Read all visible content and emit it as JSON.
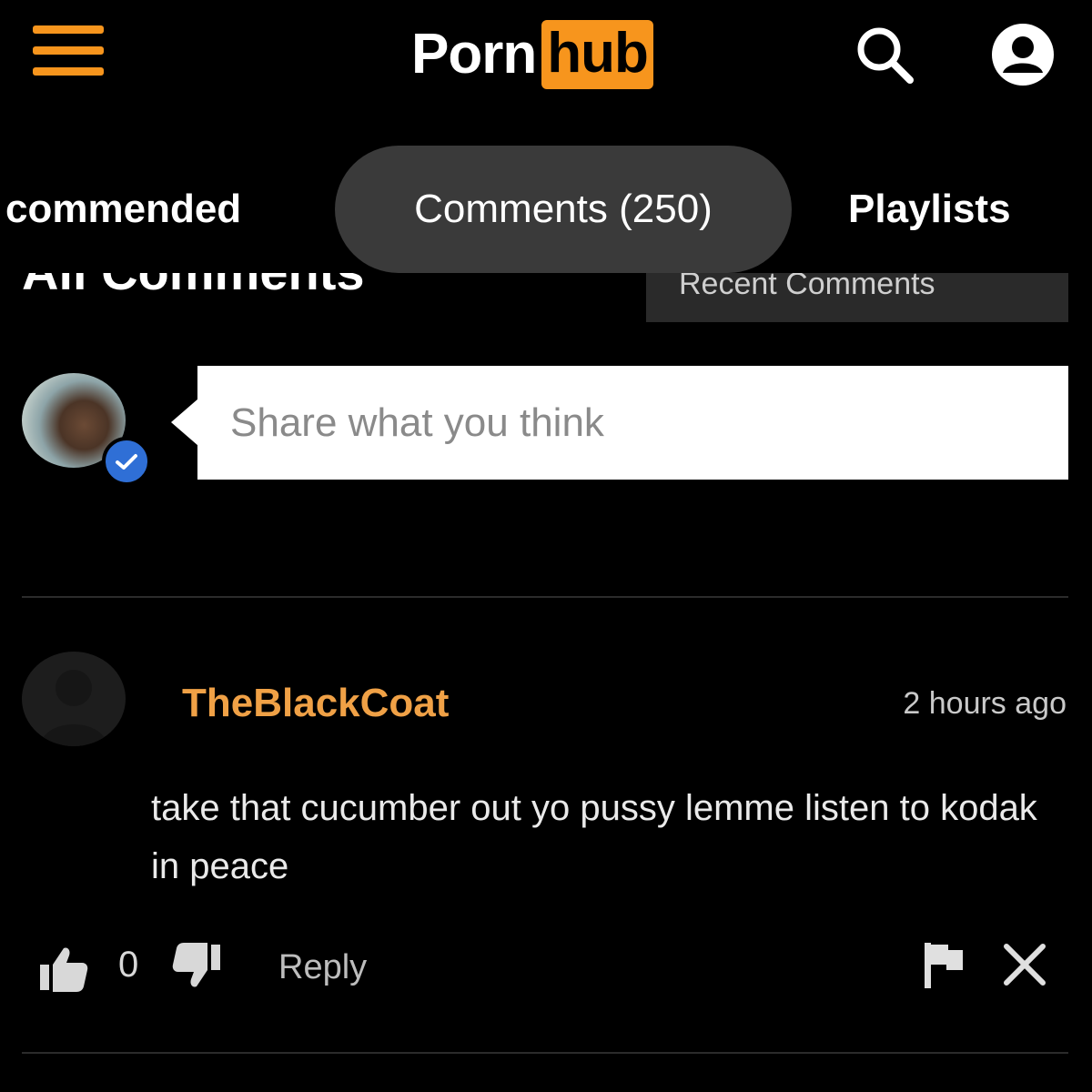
{
  "header": {
    "logo_left": "Porn",
    "logo_right": "hub",
    "menu_icon": "hamburger-menu-icon",
    "search_icon": "search-icon",
    "account_icon": "account-icon"
  },
  "tabs": [
    {
      "label": "commended"
    },
    {
      "label": "Comments (250)"
    },
    {
      "label": "Playlists"
    }
  ],
  "section": {
    "title": "All Comments",
    "sort_value": "Recent Comments"
  },
  "compose": {
    "placeholder": "Share what you think"
  },
  "comment": {
    "author": "TheBlackCoat",
    "timestamp": "2 hours ago",
    "body": "take that cucumber out yo pussy lemme listen to kodak in peace",
    "votes": "0",
    "reply_label": "Reply"
  },
  "colors": {
    "brand": "#f7951d",
    "author": "#f0a146",
    "active_tab_bg": "#3a3a3a",
    "background": "#000000",
    "verified": "#2f6fd6"
  }
}
